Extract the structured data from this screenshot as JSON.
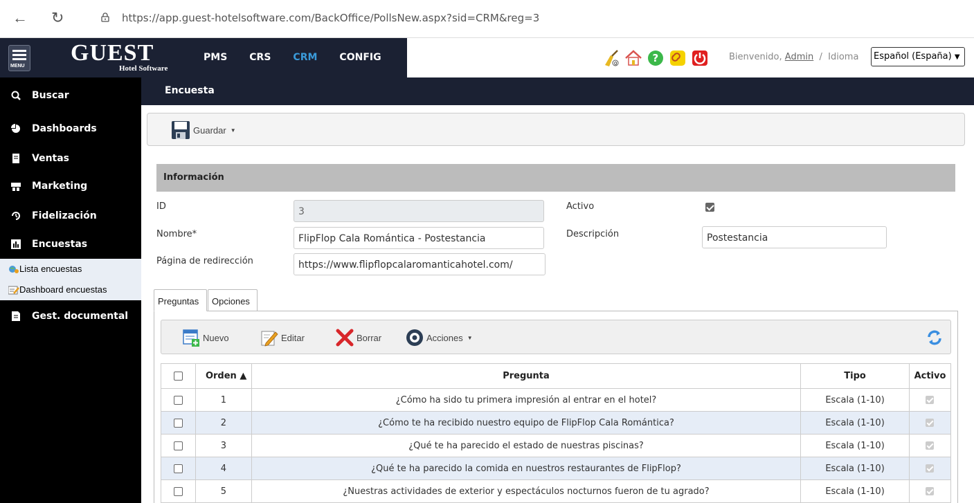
{
  "browser": {
    "url": "https://app.guest-hotelsoftware.com/BackOffice/PollsNew.aspx?sid=CRM&reg=3"
  },
  "header": {
    "menu_label": "MENU",
    "logo_main": "GUEST",
    "logo_sub": "Hotel Software",
    "nav": [
      "PMS",
      "CRS",
      "CRM",
      "CONFIG"
    ],
    "active_nav": "CRM",
    "welcome_prefix": "Bienvenido,",
    "username": "Admin",
    "separator": "/",
    "language_label": "Idioma",
    "language_value": "Español (España)",
    "accent_color": "#3a9ad9",
    "brand_bg": "#1b2133"
  },
  "sidebar": {
    "items": [
      {
        "label": "Buscar",
        "icon": "search-icon"
      },
      {
        "label": "Dashboards",
        "icon": "pie-chart-icon"
      },
      {
        "label": "Ventas",
        "icon": "receipt-icon"
      },
      {
        "label": "Marketing",
        "icon": "megaphone-icon"
      },
      {
        "label": "Fidelización",
        "icon": "history-icon"
      },
      {
        "label": "Encuestas",
        "icon": "bar-chart-icon"
      }
    ],
    "subitems": [
      {
        "label": "Lista encuestas",
        "icon": "globe-list-icon"
      },
      {
        "label": "Dashboard encuestas",
        "icon": "edit-note-icon"
      }
    ],
    "bottom_item": {
      "label": "Gest. documental",
      "icon": "document-icon"
    }
  },
  "page": {
    "title": "Encuesta",
    "save_label": "Guardar",
    "section_title": "Información"
  },
  "form": {
    "id_label": "ID",
    "id_value": "3",
    "active_label": "Activo",
    "active_checked": true,
    "name_label": "Nombre*",
    "name_value": "FlipFlop Cala Romántica - Postestancia",
    "description_label": "Descripción",
    "description_value": "Postestancia",
    "redirect_label": "Página de redirección",
    "redirect_value": "https://www.flipflopcalaromanticahotel.com/"
  },
  "tabs": [
    "Preguntas",
    "Opciones"
  ],
  "grid_toolbar": {
    "new_label": "Nuevo",
    "edit_label": "Editar",
    "delete_label": "Borrar",
    "actions_label": "Acciones"
  },
  "table": {
    "columns": [
      "",
      "Orden ▲",
      "Pregunta",
      "Tipo",
      "Activo"
    ],
    "rows": [
      {
        "orden": "1",
        "pregunta": "¿Cómo ha sido tu primera impresión al entrar en el hotel?",
        "tipo": "Escala (1-10)"
      },
      {
        "orden": "2",
        "pregunta": "¿Cómo te ha recibido nuestro equipo de FlipFlop Cala Romántica?",
        "tipo": "Escala (1-10)"
      },
      {
        "orden": "3",
        "pregunta": "¿Qué te ha parecido el estado de nuestras piscinas?",
        "tipo": "Escala (1-10)"
      },
      {
        "orden": "4",
        "pregunta": "¿Qué te ha parecido la comida en nuestros restaurantes de FlipFlop?",
        "tipo": "Escala (1-10)"
      },
      {
        "orden": "5",
        "pregunta": "¿Nuestras actividades de exterior y espectáculos nocturnos fueron de tu agrado?",
        "tipo": "Escala (1-10)"
      }
    ]
  }
}
